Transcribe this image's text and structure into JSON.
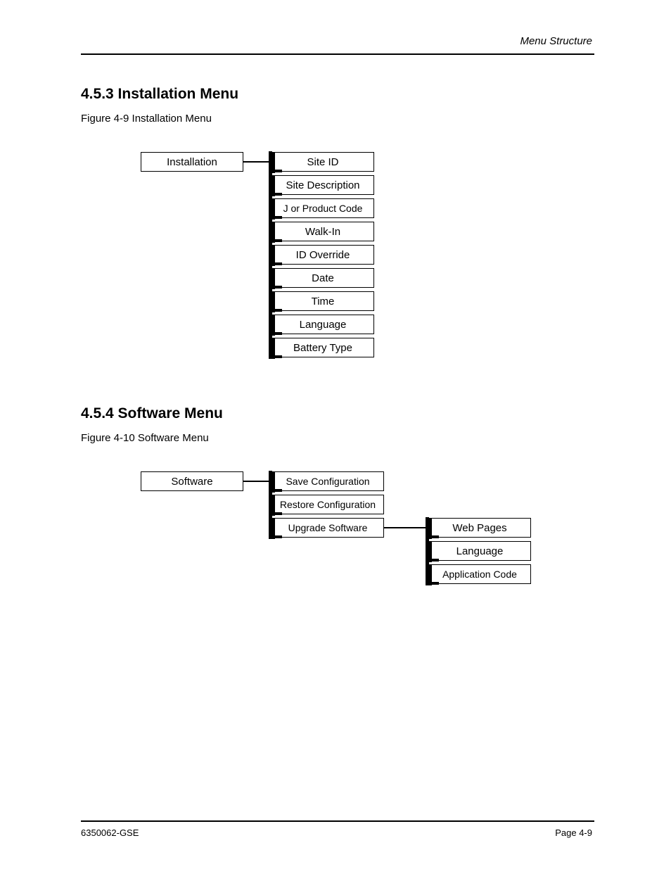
{
  "header": {
    "right": "Menu Structure"
  },
  "footer": {
    "left": "6350062-GSE",
    "right": "Page 4-9"
  },
  "section1": {
    "title": "4.5.3 Installation Menu",
    "caption": "Figure 4-9 Installation Menu",
    "root": "Installation",
    "items": [
      "Site ID",
      "Site Description",
      "J or Product Code",
      "Walk-In",
      "ID Override",
      "Date",
      "Time",
      "Language",
      "Battery Type"
    ]
  },
  "section2": {
    "title": "4.5.4 Software Menu",
    "caption": "Figure 4-10 Software Menu",
    "root": "Software",
    "items": [
      "Save Configuration",
      "Restore Configuration",
      "Upgrade Software"
    ],
    "subitems": [
      "Web Pages",
      "Language",
      "Application Code"
    ]
  }
}
